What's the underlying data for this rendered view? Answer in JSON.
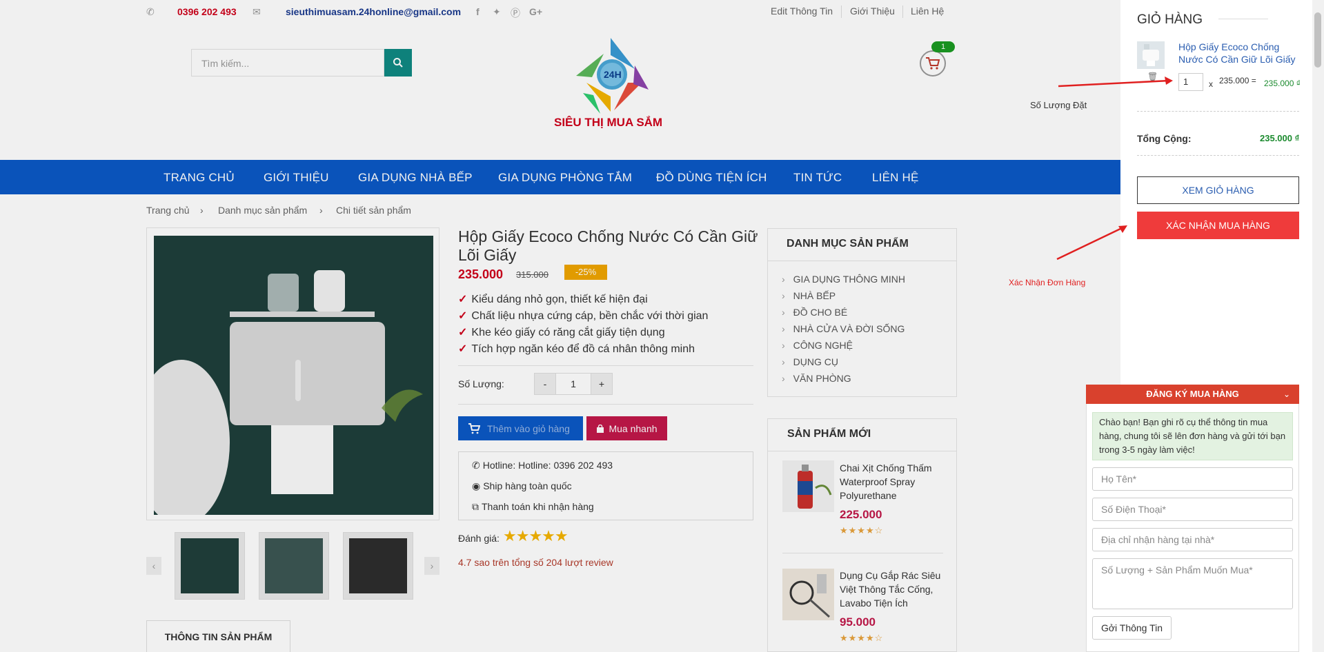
{
  "topbar": {
    "phone": "0396 202 493",
    "email": "sieuthimuasam.24honline@gmail.com",
    "links": [
      "Edit Thông Tin",
      "Giới Thiệu",
      "Liên Hệ"
    ]
  },
  "header": {
    "search_placeholder": "Tìm kiếm...",
    "logo_text": "SIÊU THỊ MUA SẮM",
    "logo_badge": "24H",
    "cart_count": "1"
  },
  "nav": {
    "items": [
      "TRANG CHỦ",
      "GIỚI THIỆU",
      "GIA DỤNG NHÀ BẾP",
      "GIA DỤNG PHÒNG TẮM",
      "ĐỒ DÙNG TIỆN ÍCH",
      "TIN TỨC",
      "LIÊN HỆ"
    ]
  },
  "breadcrumb": [
    "Trang chủ",
    "Danh mục sản phẩm",
    "Chi tiết sản phẩm"
  ],
  "product": {
    "title": "Hộp Giấy Ecoco Chống Nước Có Cần Giữ Lõi Giấy",
    "price": "235.000",
    "old_price": "315.000",
    "discount": "-25%",
    "features": [
      "Kiểu dáng nhỏ gọn, thiết kế hiện đại",
      "Chất liệu nhựa cứng cáp, bền chắc với thời gian",
      "Khe kéo giấy có răng cắt giấy tiện dụng",
      "Tích hợp ngăn kéo để đồ cá nhân thông minh"
    ],
    "qty_label": "Số Lượng:",
    "qty_minus": "-",
    "qty_value": "1",
    "qty_plus": "+",
    "add_to_cart": "Thêm vào giỏ hàng",
    "buy_now": "Mua nhanh",
    "hotline": "Hotline: Hotline: 0396 202 493",
    "shipping": "Ship hàng toàn quốc",
    "payment": "Thanh toán khi nhận hàng",
    "rating_label": "Đánh giá:",
    "rating_value": 4.7,
    "rating_text": "4.7 sao trên tổng số 204 lượt review",
    "tab_info": "THÔNG TIN SẢN PHẨM"
  },
  "categories": {
    "title": "DANH MỤC SẢN PHẨM",
    "items": [
      "GIA DỤNG THÔNG MINH",
      "NHÀ BẾP",
      "ĐỒ CHO BÉ",
      "NHÀ CỬA VÀ ĐỜI SỐNG",
      "CÔNG NGHỆ",
      "DỤNG CỤ",
      "VĂN PHÒNG"
    ]
  },
  "new_products": {
    "title": "SẢN PHẨM MỚI",
    "items": [
      {
        "name": "Chai Xịt Chống Thấm Waterproof Spray Polyurethane",
        "price": "225.000",
        "rating": 4.5
      },
      {
        "name": "Dụng Cụ Gắp Rác Siêu Việt Thông Tắc Cống, Lavabo Tiện Ích",
        "price": "95.000",
        "rating": 4.5
      }
    ]
  },
  "cart_panel": {
    "title": "GIỎ HÀNG",
    "item_name": "Hộp Giấy Ecoco Chống Nước Có Cần Giữ Lõi Giấy",
    "item_qty": "1",
    "times": "x",
    "unit_price": "235.000 =",
    "line_total": "235.000 ₫",
    "total_label": "Tổng Cộng:",
    "total_value": "235.000 ₫",
    "view_cart": "XEM GIỎ HÀNG",
    "confirm": "XÁC NHẬN MUA HÀNG"
  },
  "annotations": {
    "qty_note": "Số Lượng Đặt",
    "confirm_note": "Xác Nhận Đơn Hàng"
  },
  "order_form": {
    "title": "ĐĂNG KÝ MUA HÀNG",
    "message": "Chào bạn! Bạn ghi rõ cụ thể thông tin mua hàng, chung tôi sẽ lên đơn hàng và gửi tới bạn trong 3-5 ngày làm việc!",
    "name_placeholder": "Họ Tên*",
    "phone_placeholder": "Số Điện Thoại*",
    "address_placeholder": "Địa chỉ nhận hàng tại nhà*",
    "product_placeholder": "Số Lượng + Sản Phẩm Muốn Mua*",
    "submit": "Gởi Thông Tin"
  },
  "colors": {
    "nav_bg": "#0b59c6",
    "price_red": "#d0021b",
    "accent_teal": "#0f8a83",
    "confirm_red": "#ef3b3b",
    "form_header": "#d9412d"
  }
}
